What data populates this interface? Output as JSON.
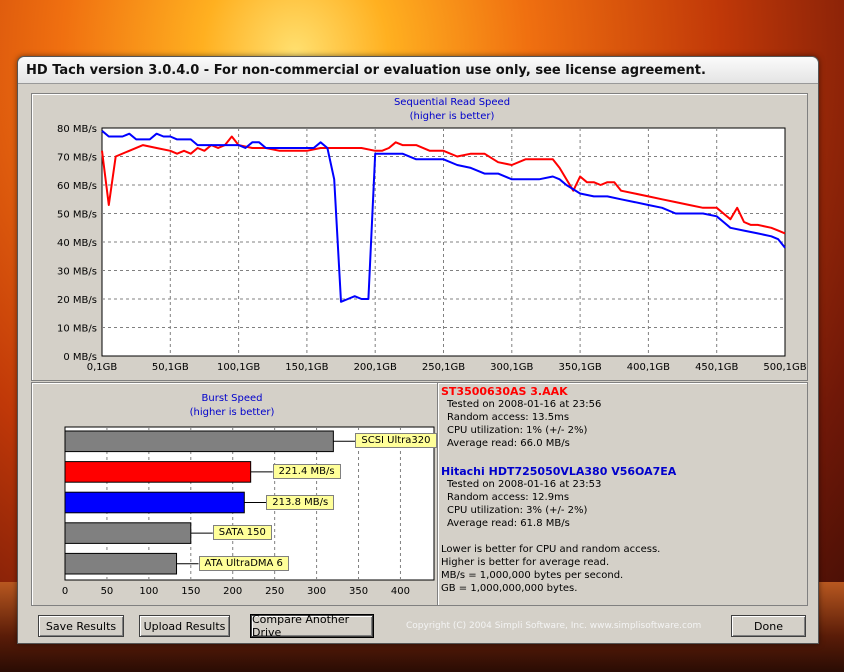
{
  "window": {
    "title": "HD Tach version 3.0.4.0  - For non-commercial or evaluation use only, see license agreement."
  },
  "colors": {
    "drive1": "#ff0000",
    "drive2": "#0000ff",
    "title_blue": "#0000cc",
    "burst_gray": "#808080",
    "label_bg": "#ffff99"
  },
  "chart_data": [
    {
      "type": "line",
      "title": "Sequential Read Speed",
      "subtitle": "(higher is better)",
      "y_ticks": [
        "0 MB/s",
        "10 MB/s",
        "20 MB/s",
        "30 MB/s",
        "40 MB/s",
        "50 MB/s",
        "60 MB/s",
        "70 MB/s",
        "80 MB/s"
      ],
      "x_ticks": [
        "0,1GB",
        "50,1GB",
        "100,1GB",
        "150,1GB",
        "200,1GB",
        "250,1GB",
        "300,1GB",
        "350,1GB",
        "400,1GB",
        "450,1GB",
        "500,1GB"
      ],
      "xlim": [
        0,
        500
      ],
      "ylim": [
        0,
        80
      ],
      "grid": true,
      "series": [
        {
          "name": "ST3500630AS 3.AAK",
          "color": "#ff0000",
          "x": [
            0,
            5,
            10,
            20,
            30,
            40,
            50,
            55,
            60,
            65,
            70,
            75,
            80,
            85,
            90,
            95,
            100,
            110,
            120,
            130,
            140,
            150,
            160,
            170,
            180,
            190,
            200,
            205,
            210,
            215,
            220,
            230,
            240,
            250,
            260,
            270,
            280,
            290,
            300,
            310,
            320,
            330,
            335,
            340,
            345,
            350,
            355,
            360,
            365,
            370,
            375,
            380,
            390,
            400,
            410,
            420,
            430,
            440,
            450,
            455,
            460,
            465,
            470,
            475,
            480,
            490,
            495,
            500
          ],
          "y": [
            72,
            53,
            70,
            72,
            74,
            73,
            72,
            71,
            72,
            71,
            73,
            72,
            74,
            73,
            74,
            77,
            74,
            73,
            73,
            72,
            72,
            72,
            73,
            73,
            73,
            73,
            72,
            72,
            73,
            75,
            74,
            74,
            72,
            72,
            70,
            71,
            71,
            68,
            67,
            69,
            69,
            69,
            66,
            62,
            58,
            63,
            61,
            61,
            60,
            61,
            61,
            58,
            57,
            56,
            55,
            54,
            53,
            52,
            52,
            50,
            48,
            52,
            47,
            46,
            46,
            45,
            44,
            43
          ]
        },
        {
          "name": "Hitachi HDT725050VLA380 V56OA7EA",
          "color": "#0000ff",
          "x": [
            0,
            5,
            10,
            15,
            20,
            25,
            30,
            35,
            40,
            45,
            50,
            55,
            60,
            65,
            70,
            75,
            80,
            85,
            90,
            95,
            100,
            105,
            110,
            115,
            120,
            125,
            130,
            135,
            140,
            145,
            150,
            155,
            160,
            165,
            170,
            175,
            180,
            185,
            190,
            195,
            200,
            205,
            210,
            215,
            220,
            230,
            240,
            250,
            260,
            270,
            280,
            290,
            300,
            310,
            320,
            330,
            335,
            340,
            350,
            360,
            370,
            380,
            390,
            400,
            410,
            420,
            430,
            440,
            450,
            455,
            460,
            470,
            480,
            490,
            495,
            500
          ],
          "y": [
            79,
            77,
            77,
            77,
            78,
            76,
            76,
            76,
            78,
            77,
            77,
            76,
            76,
            76,
            74,
            74,
            74,
            74,
            74,
            74,
            74,
            73,
            75,
            75,
            73,
            73,
            73,
            73,
            73,
            73,
            73,
            73,
            75,
            73,
            62,
            19,
            20,
            21,
            20,
            20,
            71,
            71,
            71,
            71,
            71,
            69,
            69,
            69,
            67,
            66,
            64,
            64,
            62,
            62,
            62,
            63,
            62,
            60,
            57,
            56,
            56,
            55,
            54,
            53,
            52,
            50,
            50,
            50,
            49,
            47,
            45,
            44,
            43,
            42,
            41,
            38
          ]
        }
      ]
    },
    {
      "type": "bar",
      "title": "Burst Speed",
      "subtitle": "(higher is better)",
      "x_ticks": [
        "0",
        "50",
        "100",
        "150",
        "200",
        "250",
        "300",
        "350",
        "400"
      ],
      "xlim": [
        0,
        440
      ],
      "bars": [
        {
          "label": "SCSI Ultra320",
          "value": 320,
          "color": "#808080"
        },
        {
          "label": "221.4 MB/s",
          "value": 221.4,
          "color": "#ff0000"
        },
        {
          "label": "213.8 MB/s",
          "value": 213.8,
          "color": "#0000ff"
        },
        {
          "label": "SATA 150",
          "value": 150,
          "color": "#808080"
        },
        {
          "label": "ATA UltraDMA 6",
          "value": 133,
          "color": "#808080"
        }
      ]
    }
  ],
  "drives": [
    {
      "name": "ST3500630AS 3.AAK",
      "tested": "Tested on 2008-01-16 at 23:56",
      "random_access": "Random access: 13.5ms",
      "cpu": "CPU utilization: 1% (+/- 2%)",
      "avg_read": "Average read: 66.0 MB/s"
    },
    {
      "name": "Hitachi HDT725050VLA380 V56OA7EA",
      "tested": "Tested on 2008-01-16 at 23:53",
      "random_access": "Random access: 12.9ms",
      "cpu": "CPU utilization: 3% (+/- 2%)",
      "avg_read": "Average read: 61.8 MB/s"
    }
  ],
  "notes": {
    "line1": "Lower is better for CPU and random access.",
    "line2": "Higher is better for average read.",
    "line3": "MB/s = 1,000,000 bytes per second.",
    "line4": "GB = 1,000,000,000 bytes."
  },
  "buttons": {
    "save": "Save Results",
    "upload": "Upload Results",
    "compare": "Compare Another Drive",
    "done": "Done"
  },
  "copyright": "Copyright (C) 2004 Simpli Software, Inc. www.simplisoftware.com"
}
